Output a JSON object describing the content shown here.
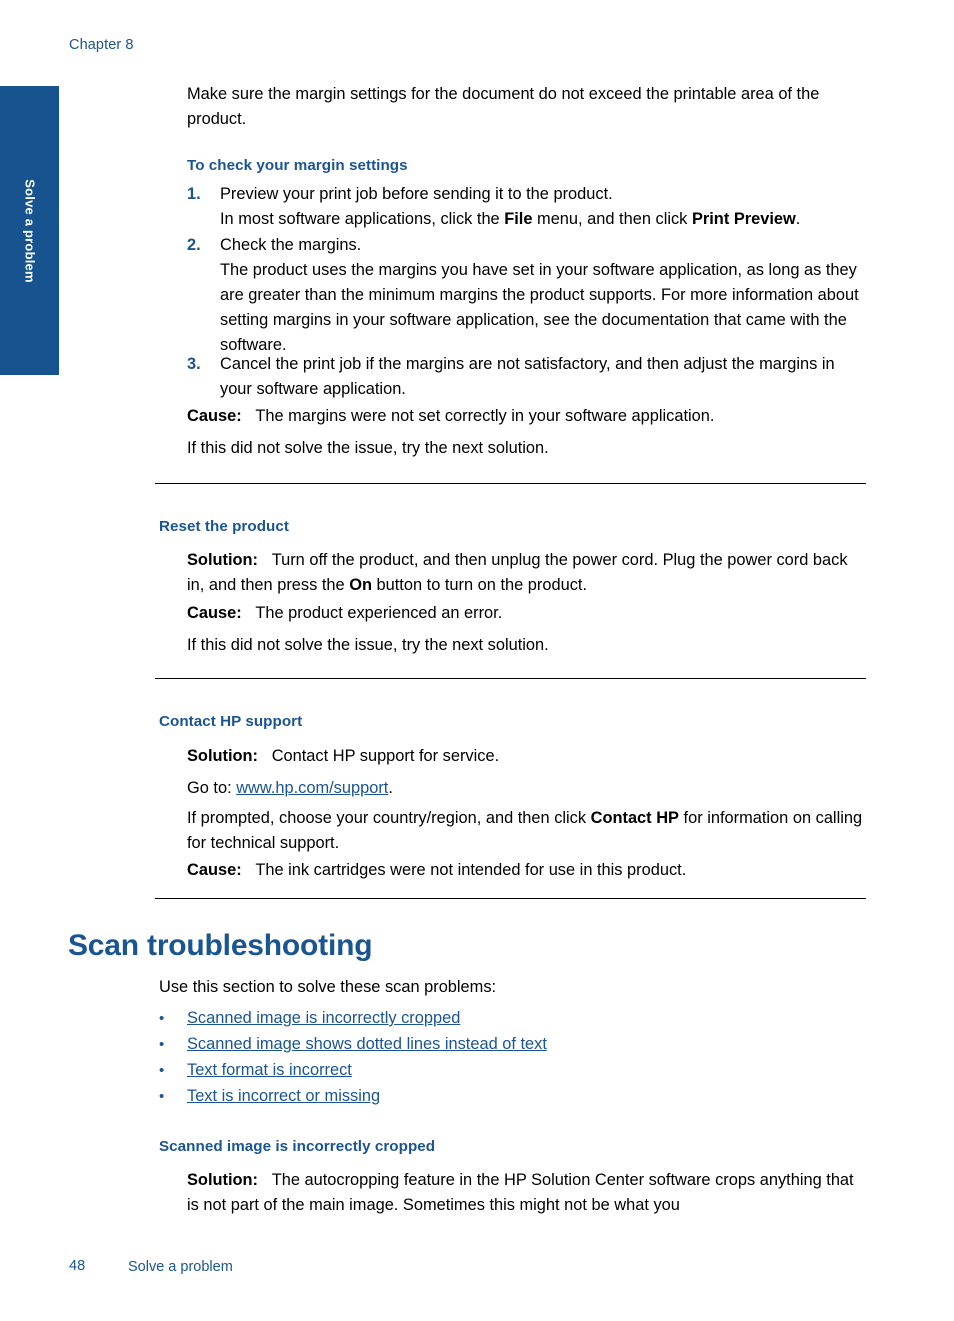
{
  "header": {
    "chapter_label": "Chapter 8"
  },
  "side_tab": {
    "label": "Solve a problem",
    "color": "#17538f"
  },
  "colors": {
    "heading_blue": "#1a5592",
    "link_blue": "#1a5592",
    "tab_blue": "#17538f",
    "body_black": "#000000"
  },
  "intro": {
    "paragraph": "Make sure the margin settings for the document do not exceed the printable area of the product."
  },
  "margin_procedure": {
    "heading": "To check your margin settings",
    "steps": [
      {
        "number": "1.",
        "line1": "Preview your print job before sending it to the product.",
        "line2_prefix": "In most software applications, click the ",
        "line2_bold1": "File",
        "line2_mid": " menu, and then click ",
        "line2_bold2": "Print Preview",
        "line2_suffix": "."
      },
      {
        "number": "2.",
        "line1": "Check the margins.",
        "line2": "The product uses the margins you have set in your software application, as long as they are greater than the minimum margins the product supports. For more information about setting margins in your software application, see the documentation that came with the software."
      },
      {
        "number": "3.",
        "line1": "Cancel the print job if the margins are not satisfactory, and then adjust the margins in your software application."
      }
    ],
    "cause_label": "Cause:",
    "cause_text": "The margins were not set correctly in your software application.",
    "next_solution": "If this did not solve the issue, try the next solution."
  },
  "reset_product": {
    "heading": "Reset the product",
    "solution_label": "Solution:",
    "solution_part1": "Turn off the product, and then unplug the power cord. Plug the power cord back in, and then press the ",
    "solution_bold": "On",
    "solution_part2": " button to turn on the product.",
    "cause_label": "Cause:",
    "cause_text": "The product experienced an error.",
    "next_solution": "If this did not solve the issue, try the next solution."
  },
  "contact_hp": {
    "heading": "Contact HP support",
    "solution_label": "Solution:",
    "solution_text": "Contact HP support for service.",
    "goto_prefix": "Go to: ",
    "goto_link": "www.hp.com/support",
    "goto_suffix": ".",
    "prompt_part1": "If prompted, choose your country/region, and then click ",
    "prompt_bold": "Contact HP",
    "prompt_part2": " for information on calling for technical support.",
    "cause_label": "Cause:",
    "cause_text": "The ink cartridges were not intended for use in this product."
  },
  "scan_troubleshooting": {
    "heading": "Scan troubleshooting",
    "intro": "Use this section to solve these scan problems:",
    "bullet_glyph": "•",
    "links": [
      "Scanned image is incorrectly cropped",
      "Scanned image shows dotted lines instead of text",
      "Text format is incorrect",
      "Text is incorrect or missing"
    ]
  },
  "cropped_section": {
    "heading": "Scanned image is incorrectly cropped",
    "solution_label": "Solution:",
    "solution_text": "The autocropping feature in the HP Solution Center software crops anything that is not part of the main image. Sometimes this might not be what you"
  },
  "footer": {
    "page_number": "48",
    "section_label": "Solve a problem"
  }
}
